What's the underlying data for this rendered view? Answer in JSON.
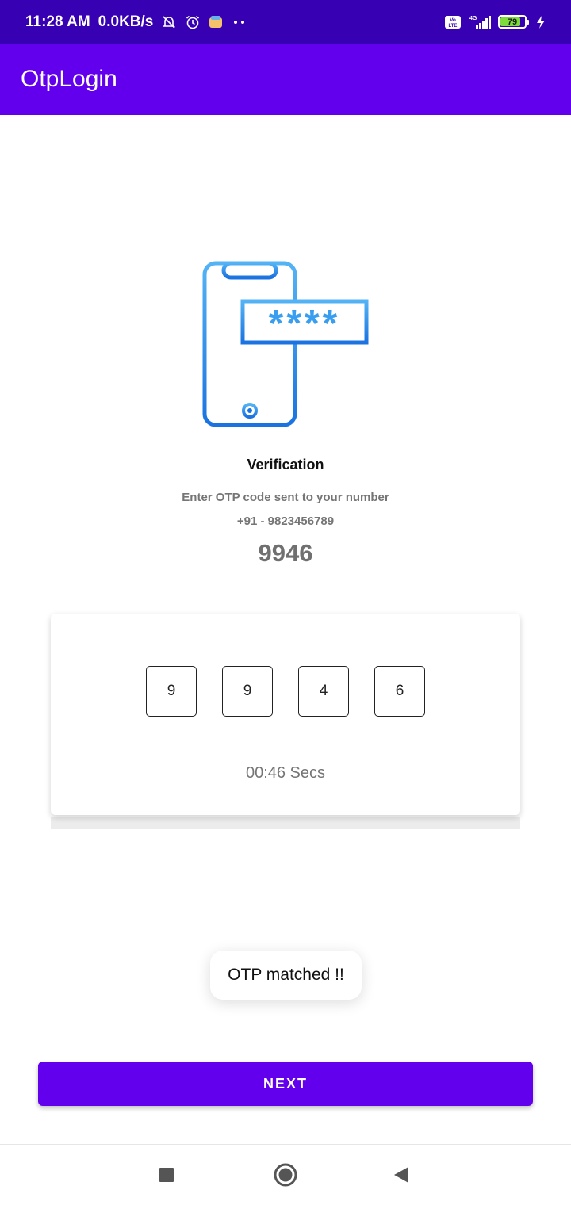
{
  "status_bar": {
    "time": "11:28 AM",
    "net_speed": "0.0KB/s",
    "volte": "Vo LTE",
    "network": "4G",
    "battery_level": "79",
    "icons": [
      "notifications-off-icon",
      "alarm-icon",
      "app-notification-icon",
      "more-dots-icon",
      "volte-icon",
      "signal-icon",
      "battery-icon",
      "charging-icon"
    ]
  },
  "app_bar": {
    "title": "OtpLogin"
  },
  "verification": {
    "title": "Verification",
    "subtitle": "Enter OTP code sent to your number",
    "phone": "+91 - 9823456789",
    "otp_code": "9946",
    "hero_icon": "phone-otp-icon",
    "hero_mask": "****"
  },
  "otp_card": {
    "digits": [
      "9",
      "9",
      "4",
      "6"
    ],
    "timer": "00:46 Secs"
  },
  "toast": {
    "message": "OTP matched !!"
  },
  "next_button": {
    "label": "NEXT"
  },
  "nav_bar": {
    "icons": [
      "recents-icon",
      "home-icon",
      "back-icon"
    ]
  },
  "colors": {
    "status_bar": "#3700b3",
    "primary": "#6200ee",
    "hero_gradient_top": "#54b3f5",
    "hero_gradient_bottom": "#1a73e0",
    "muted_text": "#757575"
  }
}
